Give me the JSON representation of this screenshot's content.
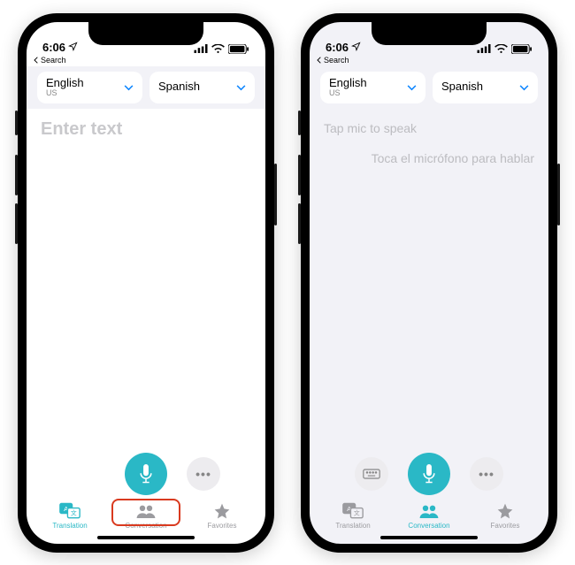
{
  "status": {
    "time": "6:06",
    "back_label": "Search"
  },
  "languages": {
    "from_main": "English",
    "from_sub": "US",
    "to_main": "Spanish",
    "to_sub": ""
  },
  "screen1": {
    "placeholder": "Enter text"
  },
  "screen2": {
    "line1": "Tap mic to speak",
    "line2": "Toca el micrófono para hablar"
  },
  "tabs": {
    "translation": "Translation",
    "conversation": "Conversation",
    "favorites": "Favorites"
  },
  "colors": {
    "accent": "#2ab8c6",
    "ios_blue": "#0a84ff",
    "highlight": "#d93a1f"
  }
}
